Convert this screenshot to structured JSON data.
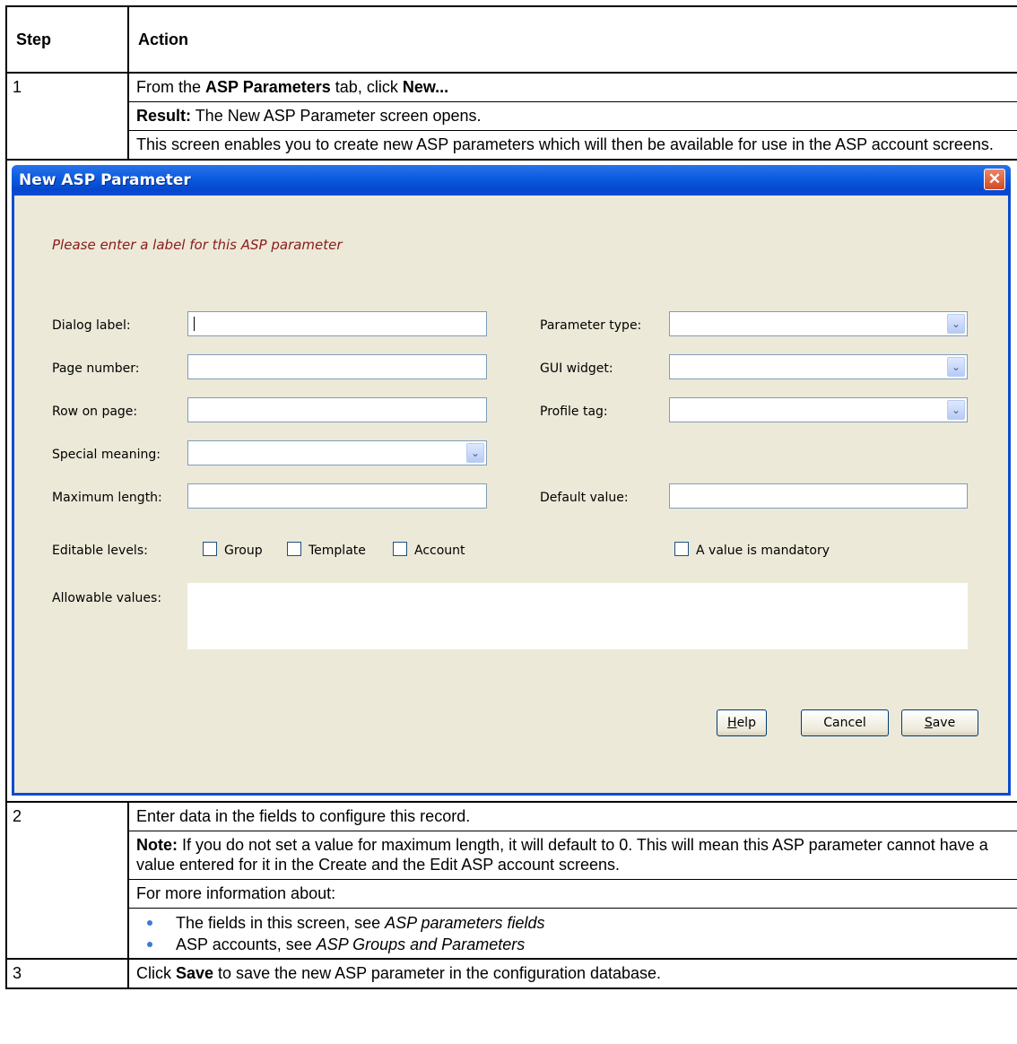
{
  "table": {
    "header": {
      "step": "Step",
      "action": "Action"
    },
    "rows": [
      {
        "step": "1",
        "p1_pre": "From the ",
        "p1_b1": "ASP Parameters",
        "p1_mid": " tab, click ",
        "p1_b2": "New...",
        "p2_b": "Result:",
        "p2_text": " The New ASP Parameter screen opens.",
        "p3": "This screen enables you to create new ASP parameters which will then be available for use in the ASP account screens."
      },
      {
        "step": "2",
        "p1": "Enter data in the fields to configure this record.",
        "p2_b": "Note:",
        "p2_text": " If you do not set a value for maximum length, it will default to 0. This will mean this ASP parameter cannot have a value entered for it in the Create and the Edit ASP account screens.",
        "p3": "For more information about:",
        "b1_pre": "The fields in this screen, see ",
        "b1_i": "ASP parameters fields",
        "b2_pre": "ASP accounts, see ",
        "b2_i": "ASP Groups and Parameters"
      },
      {
        "step": "3",
        "p1_pre": "Click ",
        "p1_b": "Save",
        "p1_post": " to save the new ASP parameter in the configuration database."
      }
    ]
  },
  "dialog": {
    "title": "New ASP Parameter",
    "close_glyph": "✕",
    "prompt": "Please enter a label for this ASP parameter",
    "labels": {
      "dialog_label": "Dialog label:",
      "page_number": "Page number:",
      "row_on_page": "Row on page:",
      "special_meaning": "Special meaning:",
      "maximum_length": "Maximum length:",
      "editable_levels": "Editable levels:",
      "allowable_values": "Allowable values:",
      "parameter_type": "Parameter type:",
      "gui_widget": "GUI widget:",
      "profile_tag": "Profile tag:",
      "default_value": "Default value:"
    },
    "checkboxes": {
      "group": "Group",
      "template": "Template",
      "account": "Account",
      "mandatory": "A value is mandatory"
    },
    "buttons": {
      "help_mn": "H",
      "help_rest": "elp",
      "cancel": "Cancel",
      "save_mn": "S",
      "save_rest": "ave"
    },
    "combo_arrow": "⌄"
  }
}
